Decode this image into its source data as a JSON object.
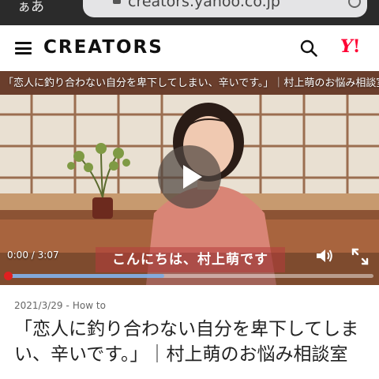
{
  "browser": {
    "text_size_button": "ぁあ",
    "url": "creators.yahoo.co.jp"
  },
  "header": {
    "logo": "CREATORS",
    "yahoo_logo": "Y!"
  },
  "video": {
    "title": "「恋人に釣り合わない自分を卑下してしまい、辛いです。」｜村上萌のお悩み相談室",
    "subtitle": "こんにちは、村上萌です",
    "current_time": "0:00",
    "duration": "3:07",
    "progress": 0.0,
    "buffered": 0.43
  },
  "article": {
    "date": "2021/3/29",
    "separator": "-",
    "category": "How to",
    "title": "「恋人に釣り合わない自分を卑下してしまい、辛いです。」｜村上萌のお悩み相談室"
  },
  "colors": {
    "accent_red": "#e02020",
    "yahoo_red": "#ff0033"
  }
}
